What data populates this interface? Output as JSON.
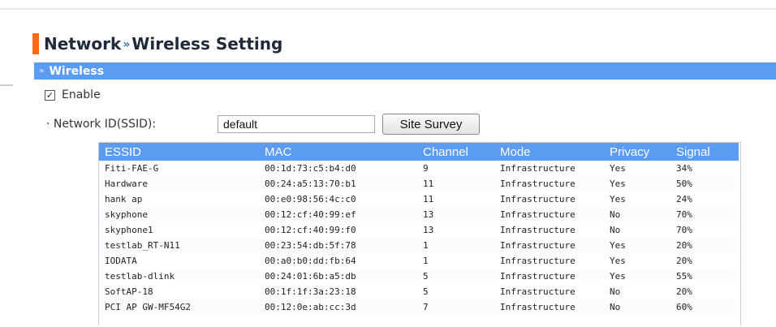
{
  "page_title": {
    "part1": "Network",
    "separator": "»",
    "part2": "Wireless Setting"
  },
  "section": {
    "title": "Wireless",
    "chevron": "»"
  },
  "enable": {
    "label": "Enable",
    "checked": true,
    "check_glyph": "✓"
  },
  "ssid": {
    "label": "· Network ID(SSID):",
    "value": "default"
  },
  "site_survey_button": "Site Survey",
  "table": {
    "columns": [
      "ESSID",
      "MAC",
      "Channel",
      "Mode",
      "Privacy",
      "Signal"
    ],
    "rows": [
      [
        "Fiti-FAE-G",
        "00:1d:73:c5:b4:d0",
        "9",
        "Infrastructure",
        "Yes",
        "34%"
      ],
      [
        "Hardware",
        "00:24:a5:13:70:b1",
        "11",
        "Infrastructure",
        "Yes",
        "50%"
      ],
      [
        "hank ap",
        "00:e0:98:56:4c:c0",
        "11",
        "Infrastructure",
        "Yes",
        "24%"
      ],
      [
        "skyphone",
        "00:12:cf:40:99:ef",
        "13",
        "Infrastructure",
        "No",
        "70%"
      ],
      [
        "skyphone1",
        "00:12:cf:40:99:f0",
        "13",
        "Infrastructure",
        "No",
        "70%"
      ],
      [
        "testlab_RT-N11",
        "00:23:54:db:5f:78",
        "1",
        "Infrastructure",
        "Yes",
        "20%"
      ],
      [
        "IODATA",
        "00:a0:b0:dd:fb:64",
        "1",
        "Infrastructure",
        "Yes",
        "20%"
      ],
      [
        "testlab-dlink",
        "00:24:01:6b:a5:db",
        "5",
        "Infrastructure",
        "Yes",
        "55%"
      ],
      [
        "SoftAP-18",
        "00:1f:1f:3a:23:18",
        "5",
        "Infrastructure",
        "No",
        "20%"
      ],
      [
        "PCI AP GW-MF54G2",
        "00:12:0e:ab:cc:3d",
        "7",
        "Infrastructure",
        "No",
        "60%"
      ]
    ]
  },
  "colors": {
    "accent": "#ff6a13",
    "header_blue": "#5b9bf0",
    "title_text": "#1f2a3a"
  }
}
